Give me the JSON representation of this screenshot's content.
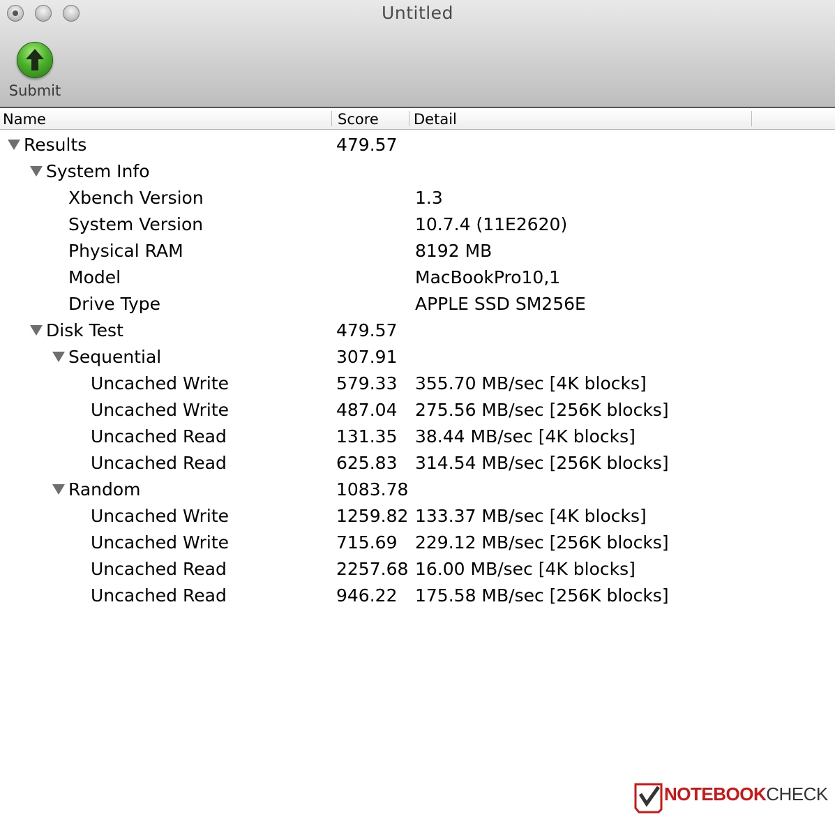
{
  "window": {
    "title": "Untitled"
  },
  "toolbar": {
    "submit_label": "Submit",
    "submit_icon": "green-up-arrow-icon"
  },
  "columns": {
    "name": "Name",
    "score": "Score",
    "detail": "Detail"
  },
  "rows": [
    {
      "level": 0,
      "expanded": true,
      "name": "Results",
      "score": "479.57",
      "detail": ""
    },
    {
      "level": 1,
      "expanded": true,
      "name": "System Info",
      "score": "",
      "detail": ""
    },
    {
      "level": 2,
      "name": "Xbench Version",
      "score": "",
      "detail": "1.3"
    },
    {
      "level": 2,
      "name": "System Version",
      "score": "",
      "detail": "10.7.4 (11E2620)"
    },
    {
      "level": 2,
      "name": "Physical RAM",
      "score": "",
      "detail": "8192 MB"
    },
    {
      "level": 2,
      "name": "Model",
      "score": "",
      "detail": "MacBookPro10,1"
    },
    {
      "level": 2,
      "name": "Drive Type",
      "score": "",
      "detail": "APPLE SSD SM256E"
    },
    {
      "level": 1,
      "expanded": true,
      "name": "Disk Test",
      "score": "479.57",
      "detail": ""
    },
    {
      "level": 2,
      "expanded": true,
      "name": "Sequential",
      "score": "307.91",
      "detail": ""
    },
    {
      "level": 3,
      "name": "Uncached Write",
      "score": "579.33",
      "detail": "355.70 MB/sec [4K blocks]"
    },
    {
      "level": 3,
      "name": "Uncached Write",
      "score": "487.04",
      "detail": "275.56 MB/sec [256K blocks]"
    },
    {
      "level": 3,
      "name": "Uncached Read",
      "score": "131.35",
      "detail": "38.44 MB/sec [4K blocks]"
    },
    {
      "level": 3,
      "name": "Uncached Read",
      "score": "625.83",
      "detail": "314.54 MB/sec [256K blocks]"
    },
    {
      "level": 2,
      "expanded": true,
      "name": "Random",
      "score": "1083.78",
      "detail": ""
    },
    {
      "level": 3,
      "name": "Uncached Write",
      "score": "1259.82",
      "detail": "133.37 MB/sec [4K blocks]"
    },
    {
      "level": 3,
      "name": "Uncached Write",
      "score": "715.69",
      "detail": "229.12 MB/sec [256K blocks]"
    },
    {
      "level": 3,
      "name": "Uncached Read",
      "score": "2257.68",
      "detail": "16.00 MB/sec [4K blocks]"
    },
    {
      "level": 3,
      "name": "Uncached Read",
      "score": "946.22",
      "detail": "175.58 MB/sec [256K blocks]"
    }
  ],
  "watermark": {
    "part1": "NOTEBOOK",
    "part2": "CHECK"
  },
  "colors": {
    "accent_green": "#4cb22c",
    "watermark_red": "#d01515",
    "triangle_gray": "#6e6e6e"
  }
}
